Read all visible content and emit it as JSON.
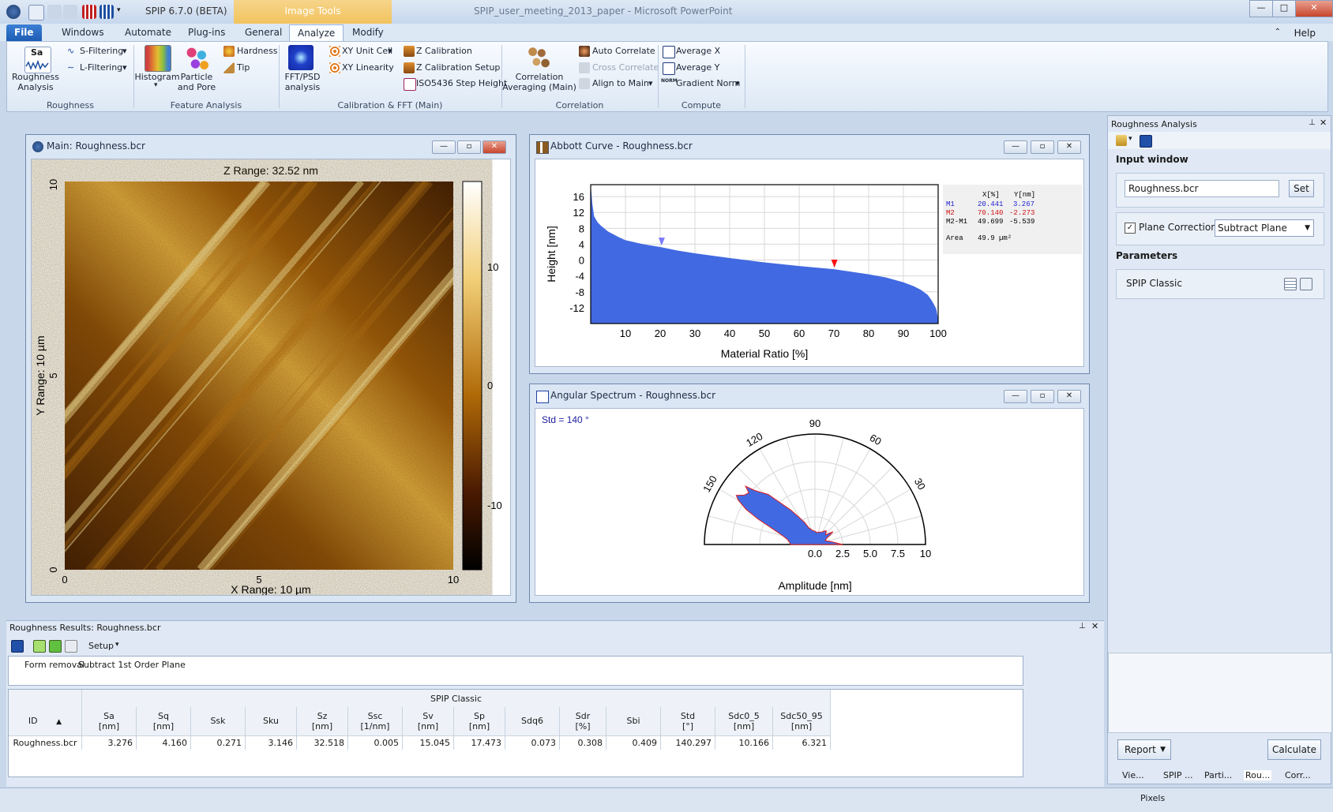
{
  "app": {
    "title": "SPIP 6.7.0 (BETA)",
    "context_tab": "Image Tools",
    "document_title": "SPIP_user_meeting_2013_paper - Microsoft PowerPoint"
  },
  "window_controls": {
    "min": "—",
    "max": "□",
    "close": "✕"
  },
  "tabs": [
    {
      "label": "File"
    },
    {
      "label": "Windows"
    },
    {
      "label": "Automate"
    },
    {
      "label": "Plug-ins"
    },
    {
      "label": "General"
    },
    {
      "label": "Analyze"
    },
    {
      "label": "Modify"
    }
  ],
  "help": "Help",
  "ribbon": {
    "roughness": {
      "sa_icon": "Sa",
      "button": "Roughness\nAnalysis",
      "s_filter": "S-Filtering",
      "l_filter": "L-Filtering",
      "group": "Roughness"
    },
    "feature": {
      "histogram": "Histogram",
      "particle": "Particle\nand Pore",
      "hardness": "Hardness",
      "tip": "Tip",
      "group": "Feature Analysis"
    },
    "calib": {
      "fft": "FFT/PSD\nanalysis",
      "xy_unit": "XY Unit Cell",
      "xy_lin": "XY Linearity",
      "z_cal": "Z Calibration",
      "z_cal_setup": "Z Calibration Setup",
      "iso": "ISO5436 Step Height",
      "group": "Calibration & FFT (Main)"
    },
    "correlation": {
      "corr_avg": "Correlation\nAveraging (Main)",
      "auto": "Auto Correlate",
      "cross": "Cross Correlate",
      "align": "Align to Main",
      "group": "Correlation"
    },
    "compute": {
      "avg_x": "Average X",
      "avg_y": "Average Y",
      "grad": "Gradient Norm",
      "norm_badge": "NORM",
      "group": "Compute"
    }
  },
  "main_window": {
    "title": "Main: Roughness.bcr",
    "z_range": "Z Range:  32.52 nm",
    "x_range": "X Range: 10 µm",
    "y_range": "Y Range: 10 µm",
    "x_ticks": [
      "0",
      "5",
      "10"
    ],
    "y_ticks": [
      "0",
      "5",
      "10"
    ],
    "colorbar_ticks": [
      "10",
      "0",
      "-10"
    ]
  },
  "abbott": {
    "title": "Abbott Curve - Roughness.bcr",
    "legend": {
      "header_x": "X[%]",
      "header_y": "Y[nm]",
      "m1": {
        "label": "M1",
        "x": "20.441",
        "y": "3.267"
      },
      "m2": {
        "label": "M2",
        "x": "70.140",
        "y": "-2.273"
      },
      "diff": {
        "label": "M2-M1",
        "x": "49.699",
        "y": "-5.539"
      },
      "area": {
        "label": "Area",
        "value": "49.9 µm²"
      }
    },
    "chart_data": {
      "type": "area",
      "xlabel": "Material Ratio [%]",
      "ylabel": "Height [nm]",
      "xlim": [
        0,
        100
      ],
      "ylim": [
        -16,
        19
      ],
      "x_ticks": [
        "10",
        "20",
        "30",
        "40",
        "50",
        "60",
        "70",
        "80",
        "90",
        "100"
      ],
      "y_ticks": [
        "16",
        "12",
        "8",
        "4",
        "0",
        "-4",
        "-8",
        "-12"
      ],
      "x": [
        0,
        0.5,
        1,
        2,
        3,
        5,
        8,
        10,
        15,
        20,
        25,
        30,
        40,
        50,
        60,
        70,
        80,
        85,
        90,
        93,
        95,
        97,
        98,
        99,
        99.5,
        100
      ],
      "y": [
        19,
        14,
        11,
        9.5,
        8.6,
        7.2,
        5.8,
        5.0,
        4.0,
        3.3,
        2.4,
        1.7,
        0.5,
        -0.6,
        -1.5,
        -2.3,
        -3.6,
        -4.4,
        -5.6,
        -6.6,
        -7.5,
        -8.8,
        -10,
        -11.5,
        -12.5,
        -15
      ],
      "markers": [
        {
          "label": "M1",
          "x": 20.441,
          "y": 3.267,
          "color": "#7b7bff"
        },
        {
          "label": "M2",
          "x": 70.14,
          "y": -2.273,
          "color": "#ff1010"
        }
      ],
      "fill_color": "#4169e1"
    }
  },
  "angular": {
    "title": "Angular Spectrum - Roughness.bcr",
    "std_label": "Std =   140 °",
    "chart_data": {
      "type": "polar-area",
      "xlabel": "Amplitude [nm]",
      "angle_ticks": [
        "30",
        "60",
        "90",
        "120",
        "150"
      ],
      "radius_ticks": [
        "0.0",
        "2.5",
        "5.0",
        "7.5",
        "10"
      ],
      "rmax": 10,
      "angles": [
        0,
        10,
        20,
        28,
        32,
        35,
        38,
        42,
        46,
        50,
        55,
        60,
        70,
        80,
        90,
        100,
        110,
        115,
        120,
        125,
        130,
        133,
        136,
        138,
        140,
        142,
        145,
        148,
        150,
        153,
        156,
        160,
        165,
        170,
        180
      ],
      "amplitudes": [
        2.5,
        1.5,
        1.0,
        1.2,
        1.6,
        2.0,
        1.7,
        1.3,
        1.4,
        1.6,
        1.5,
        1.3,
        1.2,
        1.1,
        1.2,
        1.3,
        1.6,
        2.2,
        2.8,
        3.8,
        5.0,
        6.2,
        6.8,
        7.3,
        8.2,
        7.6,
        7.8,
        8.4,
        8.0,
        7.0,
        5.6,
        4.0,
        3.0,
        2.5,
        2.2
      ],
      "fill_color": "#4169e1",
      "outline_color": "#e02020"
    }
  },
  "rpanel": {
    "title": "Roughness Analysis",
    "input_window": "Input window",
    "input_value": "Roughness.bcr",
    "set": "Set",
    "plane_correction": "Plane Correction:",
    "plane_value": "Subtract Plane",
    "parameters": "Parameters",
    "spip_classic": "SPIP Classic",
    "report": "Report",
    "calculate": "Calculate",
    "bottom_tabs": [
      "Vie...",
      "SPIP ...",
      "Parti...",
      "Rou...",
      "Corr..."
    ]
  },
  "results": {
    "title": "Roughness Results: Roughness.bcr",
    "setup": "Setup",
    "form_removal": "Form removal",
    "form_value": "Subtract 1st Order Plane",
    "group_header": "SPIP Classic",
    "id_header": "ID",
    "columns": [
      {
        "name": "Sa",
        "unit": "[nm]"
      },
      {
        "name": "Sq",
        "unit": "[nm]"
      },
      {
        "name": "Ssk",
        "unit": ""
      },
      {
        "name": "Sku",
        "unit": ""
      },
      {
        "name": "Sz",
        "unit": "[nm]"
      },
      {
        "name": "Ssc",
        "unit": "[1/nm]"
      },
      {
        "name": "Sv",
        "unit": "[nm]"
      },
      {
        "name": "Sp",
        "unit": "[nm]"
      },
      {
        "name": "Sdq6",
        "unit": ""
      },
      {
        "name": "Sdr",
        "unit": "[%]"
      },
      {
        "name": "Sbi",
        "unit": ""
      },
      {
        "name": "Std",
        "unit": "[°]"
      },
      {
        "name": "Sdc0_5",
        "unit": "[nm]"
      },
      {
        "name": "Sdc50_95",
        "unit": "[nm]"
      }
    ],
    "row": {
      "id": "Roughness.bcr",
      "values": [
        "3.276",
        "4.160",
        "0.271",
        "3.146",
        "32.518",
        "0.005",
        "15.045",
        "17.473",
        "0.073",
        "0.308",
        "0.409",
        "140.297",
        "10.166",
        "6.321"
      ]
    }
  },
  "status": {
    "pixels": "Pixels"
  },
  "colors": {
    "accent": "#1d5cb3",
    "fill": "#4169e1",
    "ribbon": "#dde8f5"
  }
}
